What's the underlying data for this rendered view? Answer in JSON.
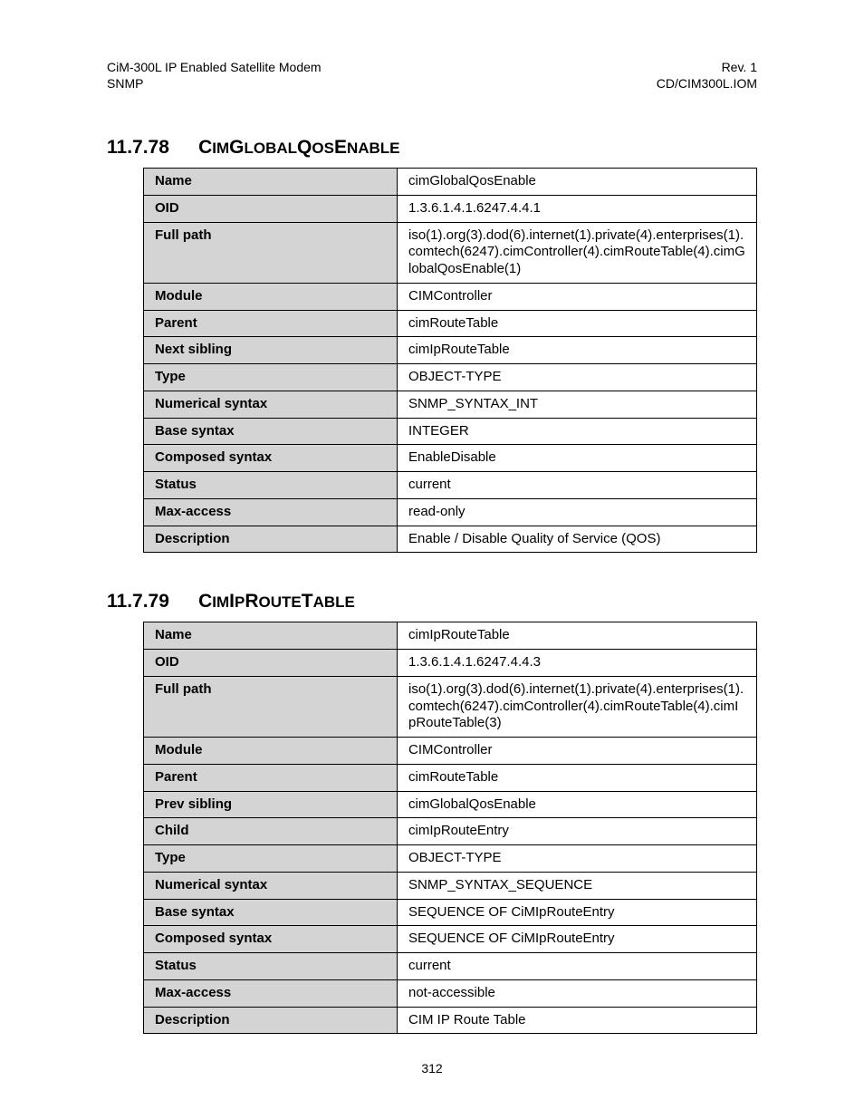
{
  "header": {
    "left_line1": "CiM-300L IP Enabled Satellite Modem",
    "left_line2": "SNMP",
    "right_line1": "Rev. 1",
    "right_line2": "CD/CIM300L.IOM"
  },
  "sections": [
    {
      "number": "11.7.78",
      "title_html": "C<span style=\"font-size:17px\">IM</span>G<span style=\"font-size:17px\">LOBAL</span>Q<span style=\"font-size:17px\">OS</span>E<span style=\"font-size:17px\">NABLE</span>",
      "rows": [
        {
          "k": "Name",
          "v": "cimGlobalQosEnable"
        },
        {
          "k": "OID",
          "v": "1.3.6.1.4.1.6247.4.4.1"
        },
        {
          "k": "Full path",
          "v": "iso(1).org(3).dod(6).internet(1).private(4).enterprises(1).comtech(6247).cimController(4).cimRouteTable(4).cimGlobalQosEnable(1)"
        },
        {
          "k": "Module",
          "v": "CIMController"
        },
        {
          "k": "Parent",
          "v": "cimRouteTable"
        },
        {
          "k": "Next sibling",
          "v": "cimIpRouteTable"
        },
        {
          "k": "Type",
          "v": "OBJECT-TYPE"
        },
        {
          "k": "Numerical syntax",
          "v": "SNMP_SYNTAX_INT"
        },
        {
          "k": "Base syntax",
          "v": "INTEGER"
        },
        {
          "k": "Composed syntax",
          "v": "EnableDisable"
        },
        {
          "k": "Status",
          "v": "current"
        },
        {
          "k": "Max-access",
          "v": "read-only"
        },
        {
          "k": "Description",
          "v": "Enable / Disable Quality of Service (QOS)"
        }
      ]
    },
    {
      "number": "11.7.79",
      "title_html": "C<span style=\"font-size:17px\">IM</span>I<span style=\"font-size:17px\">P</span>R<span style=\"font-size:17px\">OUTE</span>T<span style=\"font-size:17px\">ABLE</span>",
      "rows": [
        {
          "k": "Name",
          "v": "cimIpRouteTable"
        },
        {
          "k": "OID",
          "v": "1.3.6.1.4.1.6247.4.4.3"
        },
        {
          "k": "Full path",
          "v": "iso(1).org(3).dod(6).internet(1).private(4).enterprises(1).comtech(6247).cimController(4).cimRouteTable(4).cimIpRouteTable(3)"
        },
        {
          "k": "Module",
          "v": "CIMController"
        },
        {
          "k": "Parent",
          "v": "cimRouteTable"
        },
        {
          "k": "Prev sibling",
          "v": "cimGlobalQosEnable"
        },
        {
          "k": "Child",
          "v": "cimIpRouteEntry"
        },
        {
          "k": "Type",
          "v": "OBJECT-TYPE"
        },
        {
          "k": "Numerical syntax",
          "v": "SNMP_SYNTAX_SEQUENCE"
        },
        {
          "k": "Base syntax",
          "v": "SEQUENCE OF CiMIpRouteEntry"
        },
        {
          "k": "Composed syntax",
          "v": "SEQUENCE OF CiMIpRouteEntry"
        },
        {
          "k": "Status",
          "v": "current"
        },
        {
          "k": "Max-access",
          "v": "not-accessible"
        },
        {
          "k": "Description",
          "v": "CIM IP Route Table"
        }
      ]
    }
  ],
  "page_number": "312"
}
